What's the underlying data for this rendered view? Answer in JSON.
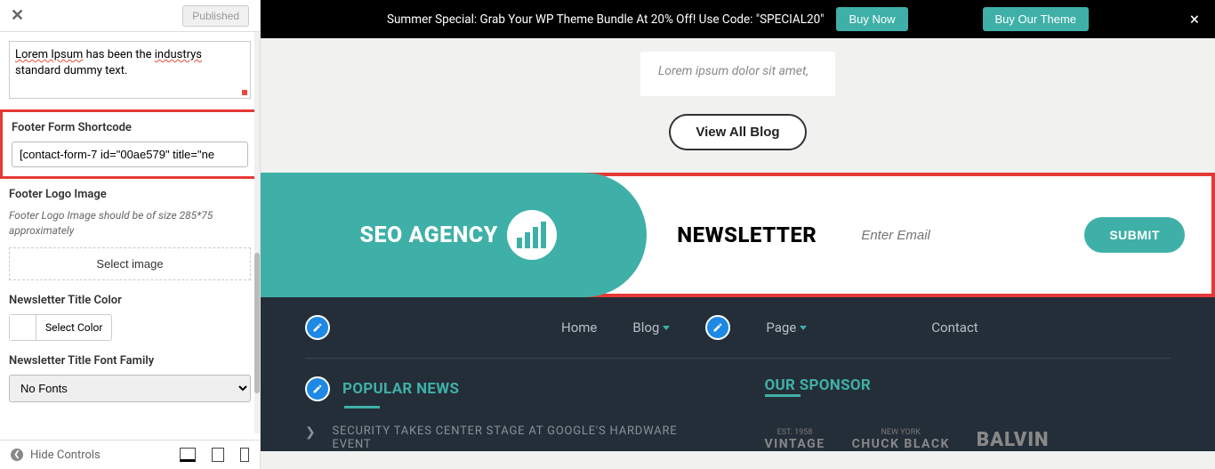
{
  "panel": {
    "published_label": "Published",
    "textarea_line1": "Lorem Ipsum",
    "textarea_line2": " has been the ",
    "textarea_word": "industrys",
    "textarea_line3": "standard dummy text.",
    "footer_form_label": "Footer Form Shortcode",
    "footer_form_value": "[contact-form-7 id=\"00ae579\" title=\"ne",
    "footer_logo_label": "Footer Logo Image",
    "footer_logo_help": "Footer Logo Image should be of size 285*75 approximately",
    "select_image_label": "Select image",
    "newsletter_color_label": "Newsletter Title Color",
    "select_color_label": "Select Color",
    "newsletter_font_label": "Newsletter Title Font Family",
    "no_fonts": "No Fonts",
    "hide_controls": "Hide Controls"
  },
  "promo": {
    "text": "Summer Special: Grab Your WP Theme Bundle At 20% Off! Use Code: \"SPECIAL20\"",
    "buy_now": "Buy Now",
    "buy_theme": "Buy Our Theme"
  },
  "content": {
    "lorem": "Lorem ipsum dolor sit amet,",
    "view_all": "View All Blog"
  },
  "logo_text": "SEO AGENCY",
  "newsletter": {
    "title": "NEWSLETTER",
    "placeholder": "Enter Email",
    "submit": "SUBMIT"
  },
  "nav": {
    "home": "Home",
    "blog": "Blog",
    "page": "Page",
    "contact": "Contact"
  },
  "footer": {
    "popular_news": "POPULAR NEWS",
    "news_item": "SECURITY TAKES CENTER STAGE AT GOOGLE'S HARDWARE EVENT",
    "our_sponsor": "OUR SPONSOR",
    "est1": "EST. 1958",
    "vintage": "VINTAGE",
    "ny": "NEW YORK",
    "chuck": "CHUCK BLACK",
    "balvin": "BALVIN"
  }
}
